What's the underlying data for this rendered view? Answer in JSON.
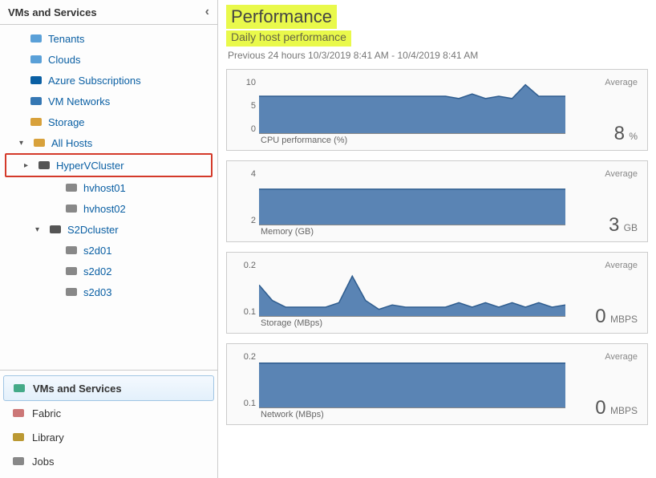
{
  "sidebar": {
    "header": "VMs and Services",
    "items": [
      {
        "label": "Tenants",
        "icon": "tenants",
        "level": 0
      },
      {
        "label": "Clouds",
        "icon": "cloud",
        "level": 0
      },
      {
        "label": "Azure Subscriptions",
        "icon": "azure",
        "level": 0
      },
      {
        "label": "VM Networks",
        "icon": "net",
        "level": 0
      },
      {
        "label": "Storage",
        "icon": "storage",
        "level": 0
      },
      {
        "label": "All Hosts",
        "icon": "folder",
        "level": 1,
        "arrow": "▾"
      },
      {
        "label": "HyperVCluster",
        "icon": "cluster",
        "level": 2,
        "arrow": "▸",
        "highlight": true
      },
      {
        "label": "hvhost01",
        "icon": "host",
        "level": 3
      },
      {
        "label": "hvhost02",
        "icon": "host",
        "level": 3
      },
      {
        "label": "S2Dcluster",
        "icon": "cluster",
        "level": 2,
        "arrow": "▾"
      },
      {
        "label": "s2d01",
        "icon": "host",
        "level": 3
      },
      {
        "label": "s2d02",
        "icon": "host",
        "level": 3
      },
      {
        "label": "s2d03",
        "icon": "host",
        "level": 3
      }
    ],
    "nav": [
      {
        "label": "VMs and Services",
        "icon": "vms",
        "active": true
      },
      {
        "label": "Fabric",
        "icon": "fabric"
      },
      {
        "label": "Library",
        "icon": "library"
      },
      {
        "label": "Jobs",
        "icon": "jobs"
      }
    ]
  },
  "performance": {
    "title": "Performance",
    "subtitle": "Daily host performance",
    "range": "Previous 24 hours  10/3/2019 8:41 AM - 10/4/2019 8:41 AM"
  },
  "chart_data": [
    {
      "type": "area",
      "title": "CPU performance (%)",
      "ylim": [
        0,
        12
      ],
      "yticks": [
        "10",
        "5",
        "0"
      ],
      "x_count": 24,
      "values": [
        8,
        8,
        8,
        8,
        8,
        8,
        8,
        8,
        8,
        8,
        8,
        8,
        8,
        8,
        8,
        7.5,
        8.5,
        7.5,
        8,
        7.5,
        10.5,
        8,
        8,
        8
      ],
      "average_label": "Average",
      "average_value": "8",
      "average_unit": "%"
    },
    {
      "type": "area",
      "title": "Memory (GB)",
      "ylim": [
        0,
        5
      ],
      "yticks": [
        "4",
        "2"
      ],
      "x_count": 24,
      "values": [
        3.2,
        3.2,
        3.2,
        3.2,
        3.2,
        3.2,
        3.2,
        3.2,
        3.2,
        3.2,
        3.2,
        3.2,
        3.2,
        3.2,
        3.2,
        3.2,
        3.2,
        3.2,
        3.2,
        3.2,
        3.2,
        3.2,
        3.2,
        3.2
      ],
      "average_label": "Average",
      "average_value": "3",
      "average_unit": "GB"
    },
    {
      "type": "area",
      "title": "Storage (MBps)",
      "ylim": [
        0,
        0.25
      ],
      "yticks": [
        "0.2",
        "0.1"
      ],
      "x_count": 24,
      "values": [
        0.14,
        0.07,
        0.04,
        0.04,
        0.04,
        0.04,
        0.06,
        0.18,
        0.07,
        0.03,
        0.05,
        0.04,
        0.04,
        0.04,
        0.04,
        0.06,
        0.04,
        0.06,
        0.04,
        0.06,
        0.04,
        0.06,
        0.04,
        0.05
      ],
      "average_label": "Average",
      "average_value": "0",
      "average_unit": "MBPS"
    },
    {
      "type": "area",
      "title": "Network (MBps)",
      "ylim": [
        0,
        0.25
      ],
      "yticks": [
        "0.2",
        "0.1"
      ],
      "x_count": 24,
      "values": [
        0.2,
        0.2,
        0.2,
        0.2,
        0.2,
        0.2,
        0.2,
        0.2,
        0.2,
        0.2,
        0.2,
        0.2,
        0.2,
        0.2,
        0.2,
        0.2,
        0.2,
        0.2,
        0.2,
        0.2,
        0.2,
        0.2,
        0.2,
        0.2
      ],
      "average_label": "Average",
      "average_value": "0",
      "average_unit": "MBPS"
    }
  ]
}
